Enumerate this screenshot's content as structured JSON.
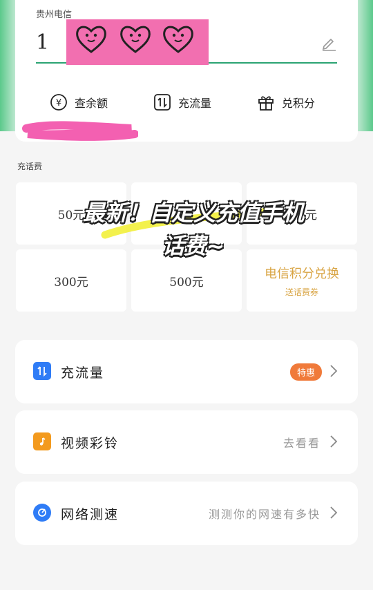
{
  "carrier": "贵州电信",
  "phone_prefix": "1",
  "quick_actions": [
    {
      "label": "查余额",
      "icon": "yen-icon"
    },
    {
      "label": "充流量",
      "icon": "data-transfer-icon"
    },
    {
      "label": "兑积分",
      "icon": "gift-icon"
    }
  ],
  "recharge": {
    "section_label": "充话费",
    "tiles": [
      "50元",
      "",
      "元",
      "300元",
      "500元"
    ],
    "points_tile": {
      "title": "电信积分兑换",
      "subtitle": "送话费券"
    }
  },
  "overlay": {
    "line1": "最新！自定义充值手机",
    "line2": "话费~"
  },
  "rows": [
    {
      "label": "充流量",
      "right": "特惠",
      "icon": "data-transfer-icon",
      "color": "#2f7cf6"
    },
    {
      "label": "视频彩铃",
      "right": "去看看",
      "icon": "music-note-icon",
      "color": "#f39a1e"
    },
    {
      "label": "网络测速",
      "right": "测测你的网速有多快",
      "icon": "speed-gauge-icon",
      "color": "#2f7cf6"
    }
  ],
  "colors": {
    "accent": "#2aa372",
    "badge": "#f07a3a",
    "gold": "#d9a545",
    "pink_redaction": "#f26fb0",
    "scribble_yellow": "#f2ef3a"
  }
}
